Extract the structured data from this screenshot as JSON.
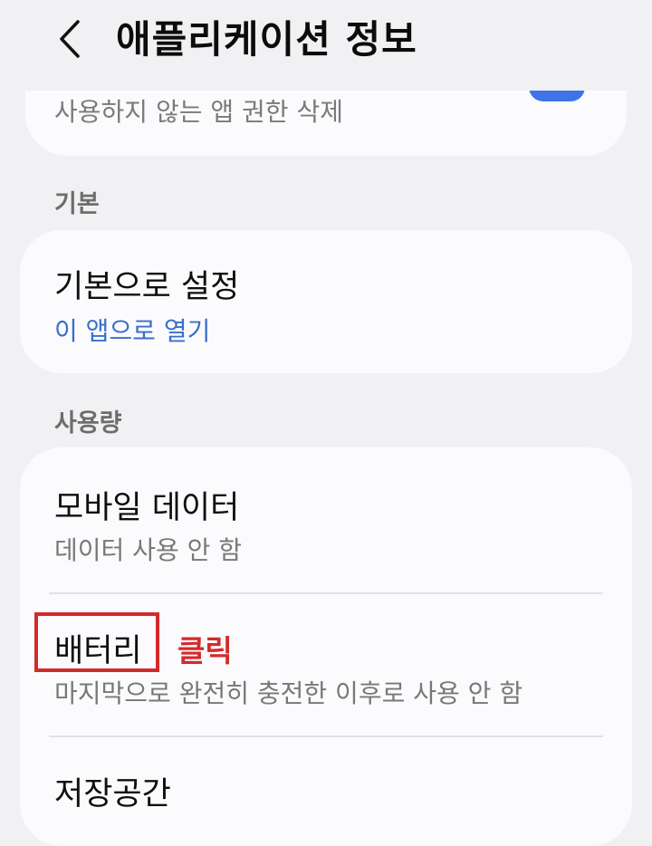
{
  "header": {
    "title": "애플리케이션 정보",
    "back_icon": "chevron-left-icon"
  },
  "top_card": {
    "subtitle": "사용하지 않는 앱 권한 삭제",
    "toggle_state": "on",
    "toggle_color": "#3f74e6"
  },
  "sections": {
    "default": {
      "label": "기본",
      "item": {
        "title": "기본으로 설정",
        "subtitle": "이 앱으로 열기",
        "subtitle_color": "#3a6fc9"
      }
    },
    "usage": {
      "label": "사용량",
      "items": [
        {
          "title": "모바일 데이터",
          "subtitle": "데이터 사용 안 함"
        },
        {
          "title": "배터리",
          "subtitle": "마지막으로 완전히 충전한 이후로 사용 안 함"
        },
        {
          "title": "저장공간"
        }
      ]
    }
  },
  "annotation": {
    "label": "클릭",
    "color": "#d42a2a"
  }
}
